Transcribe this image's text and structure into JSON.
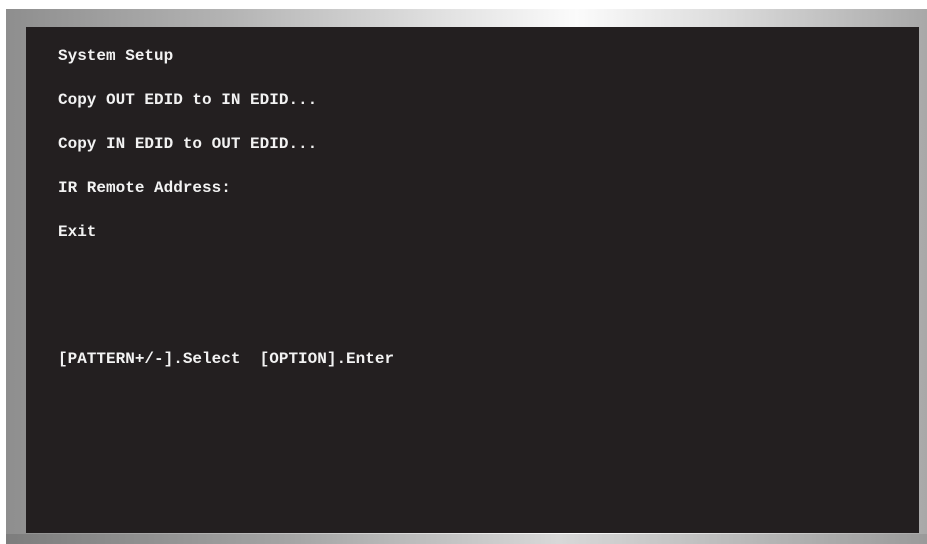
{
  "menu": {
    "items": [
      {
        "label": "System Setup"
      },
      {
        "label": "Copy OUT EDID to IN EDID..."
      },
      {
        "label": "Copy IN EDID to OUT EDID..."
      },
      {
        "label": "IR Remote Address:"
      },
      {
        "label": "Exit"
      }
    ]
  },
  "footer": {
    "hint": "[PATTERN+/-].Select  [OPTION].Enter"
  }
}
